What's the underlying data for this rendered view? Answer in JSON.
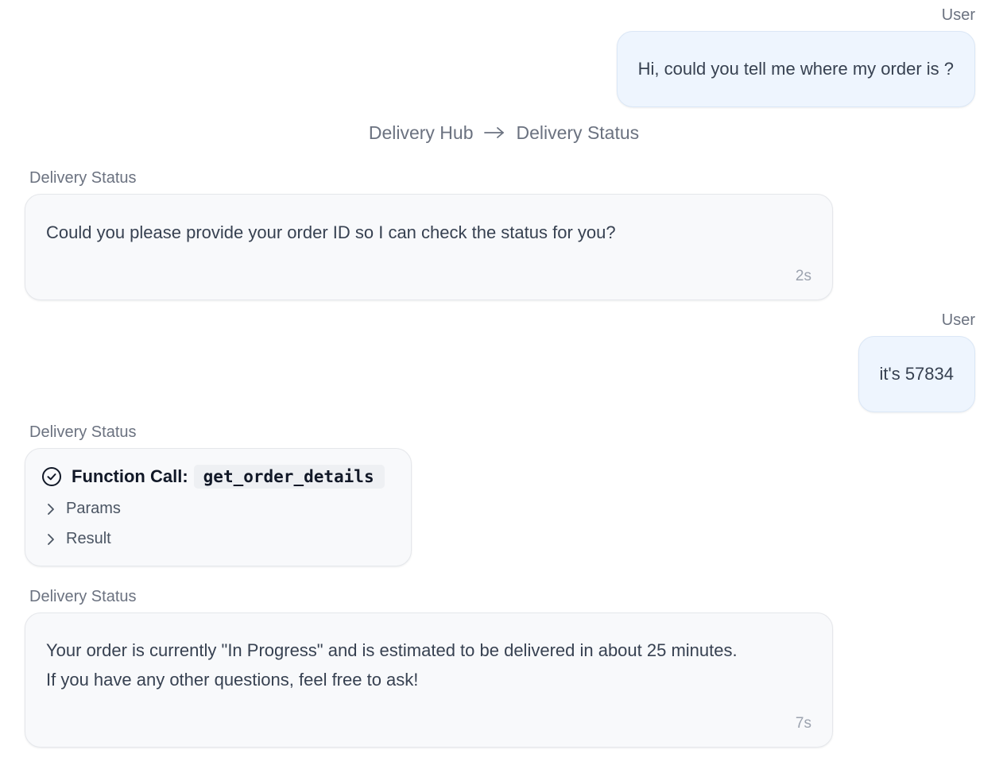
{
  "conversation": {
    "messages": [
      {
        "role": "user",
        "sender": "User",
        "text": "Hi, could you tell me where my order is ?"
      },
      {
        "role": "handoff",
        "from": "Delivery Hub",
        "to": "Delivery Status",
        "arrow_icon": "arrow-right-icon"
      },
      {
        "role": "agent",
        "sender": "Delivery Status",
        "text": "Could you please provide your order ID so I can check the status for you?",
        "time": "2s"
      },
      {
        "role": "user",
        "sender": "User",
        "text": "it's 57834"
      },
      {
        "role": "function_call",
        "sender": "Delivery Status",
        "status_icon": "check-circle-icon",
        "label": "Function Call:",
        "function_name": "get_order_details",
        "sections": [
          {
            "label": "Params",
            "icon": "chevron-right-icon"
          },
          {
            "label": "Result",
            "icon": "chevron-right-icon"
          }
        ]
      },
      {
        "role": "agent",
        "sender": "Delivery Status",
        "lines": [
          "Your order is currently \"In Progress\" and is estimated to be delivered in about 25 minutes.",
          "If you have any other questions, feel free to ask!"
        ],
        "time": "7s"
      }
    ]
  }
}
